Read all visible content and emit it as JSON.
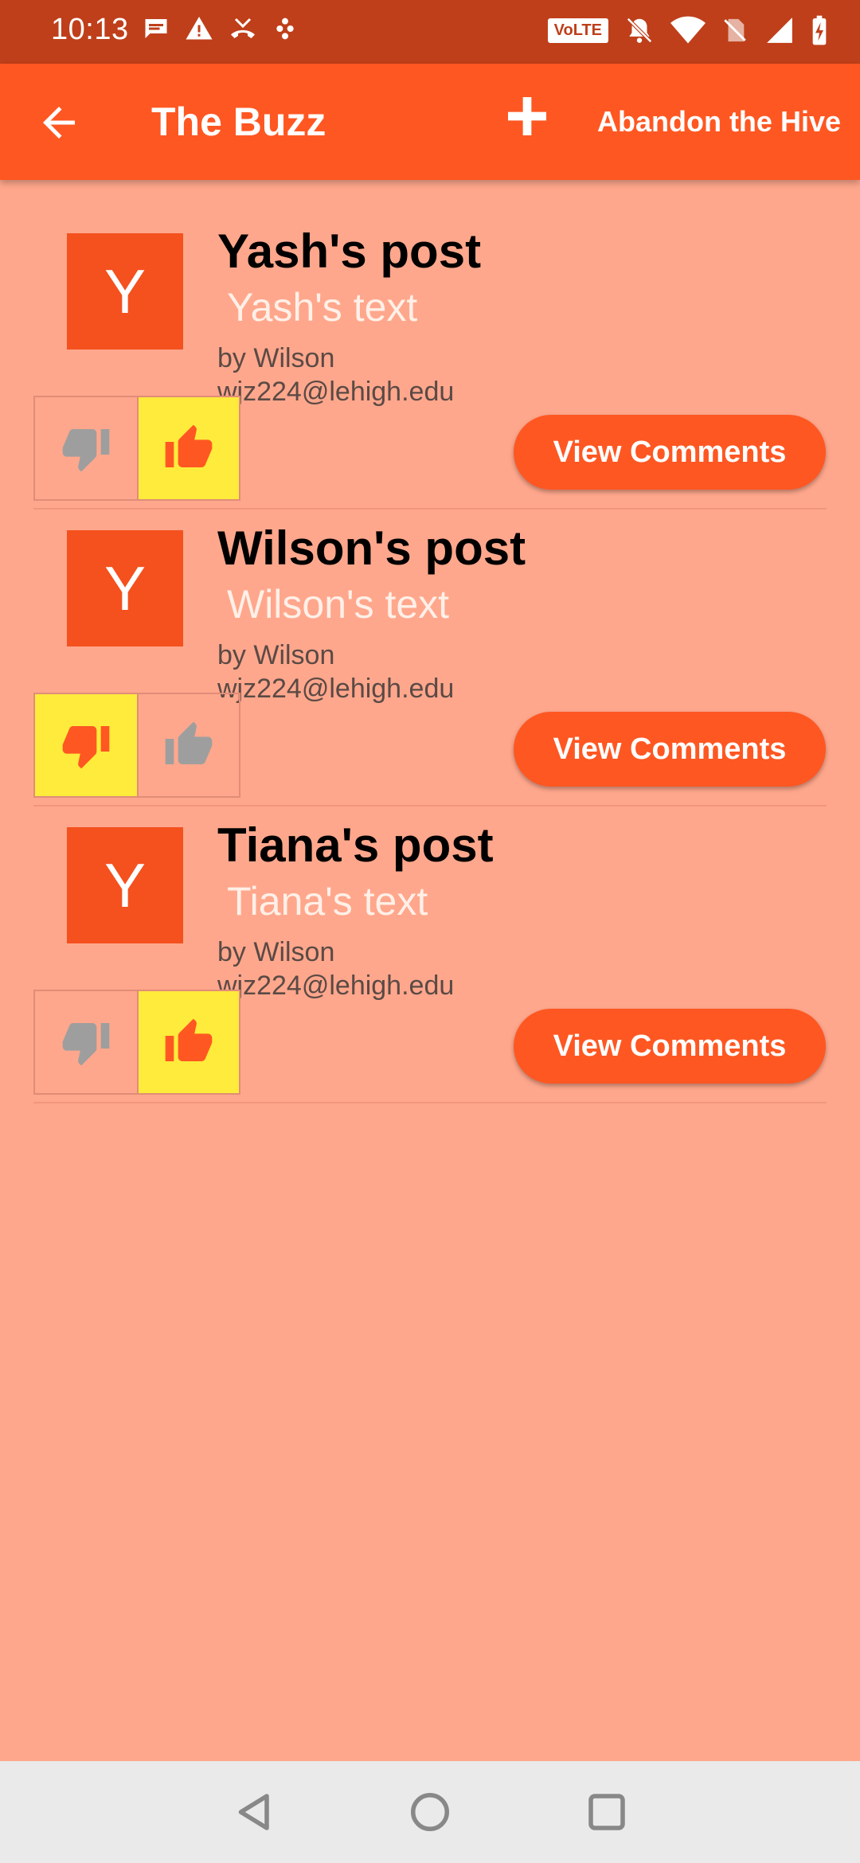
{
  "status_bar": {
    "time": "10:13",
    "left_icons": [
      "message-icon",
      "alert-icon",
      "missed-call-icon",
      "app-notification-icon"
    ],
    "volte": "VoLTE",
    "right_icons": [
      "volte-icon",
      "bell-off-icon",
      "wifi-icon",
      "no-sim-icon",
      "signal-icon",
      "battery-charging-icon"
    ]
  },
  "app_bar": {
    "title": "The Buzz",
    "abandon_label": "Abandon the Hive",
    "back_icon": "arrow-back-icon",
    "add_icon": "plus-icon"
  },
  "posts": [
    {
      "avatar_letter": "Y",
      "title": "Yash's post",
      "text": " Yash's text",
      "author": "by Wilson",
      "email": "wjz224@lehigh.edu",
      "vote": "up",
      "view_comments_label": "View Comments"
    },
    {
      "avatar_letter": "Y",
      "title": "Wilson's post",
      "text": " Wilson's text",
      "author": "by Wilson",
      "email": "wjz224@lehigh.edu",
      "vote": "down",
      "view_comments_label": "View Comments"
    },
    {
      "avatar_letter": "Y",
      "title": "Tiana's post",
      "text": " Tiana's text",
      "author": "by Wilson",
      "email": "wjz224@lehigh.edu",
      "vote": "up",
      "view_comments_label": "View Comments"
    }
  ],
  "colors": {
    "status_bar": "#BF3F1A",
    "app_bar": "#FF5722",
    "background": "#FFA78C",
    "avatar": "#F4511E",
    "active_vote": "#FFEB3B",
    "active_thumb": "#FF5722",
    "inactive_thumb": "#9E9E9E"
  },
  "nav_bar": {
    "icons": [
      "back-triangle-icon",
      "home-circle-icon",
      "recents-square-icon"
    ]
  }
}
